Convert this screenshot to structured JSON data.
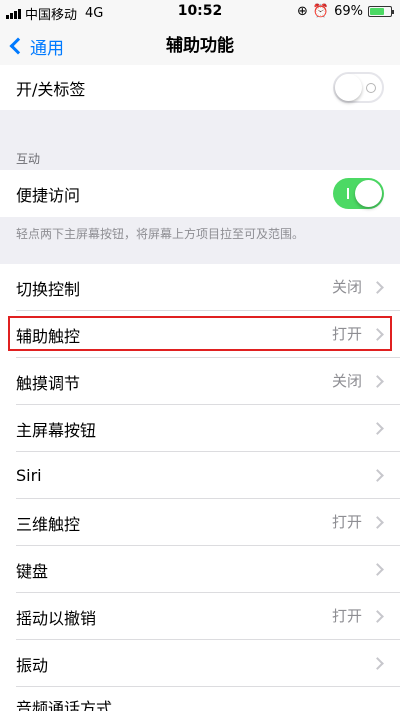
{
  "status_bar": {
    "carrier": "中国移动",
    "network": "4G",
    "time": "10:52",
    "battery_percent": "69%",
    "battery_level": 0.69
  },
  "nav": {
    "back_label": "通用",
    "title": "辅助功能"
  },
  "top_row": {
    "label": "开/关标签",
    "toggle": "off"
  },
  "interaction": {
    "header": "互动",
    "reachability": {
      "label": "便捷访问",
      "toggle": "on"
    },
    "footer": "轻点两下主屏幕按钮，将屏幕上方项目拉至可及范围。"
  },
  "settings_list": [
    {
      "label": "切换控制",
      "value": "关闭"
    },
    {
      "label": "辅助触控",
      "value": "打开"
    },
    {
      "label": "触摸调节",
      "value": "关闭"
    },
    {
      "label": "主屏幕按钮",
      "value": ""
    },
    {
      "label": "Siri",
      "value": ""
    },
    {
      "label": "三维触控",
      "value": "打开"
    },
    {
      "label": "键盘",
      "value": ""
    },
    {
      "label": "摇动以撤销",
      "value": "打开"
    },
    {
      "label": "振动",
      "value": ""
    },
    {
      "label": "音频通话方式",
      "value": ""
    }
  ],
  "colors": {
    "accent": "#007aff",
    "toggle_on": "#4cd964",
    "highlight": "#e02020"
  }
}
